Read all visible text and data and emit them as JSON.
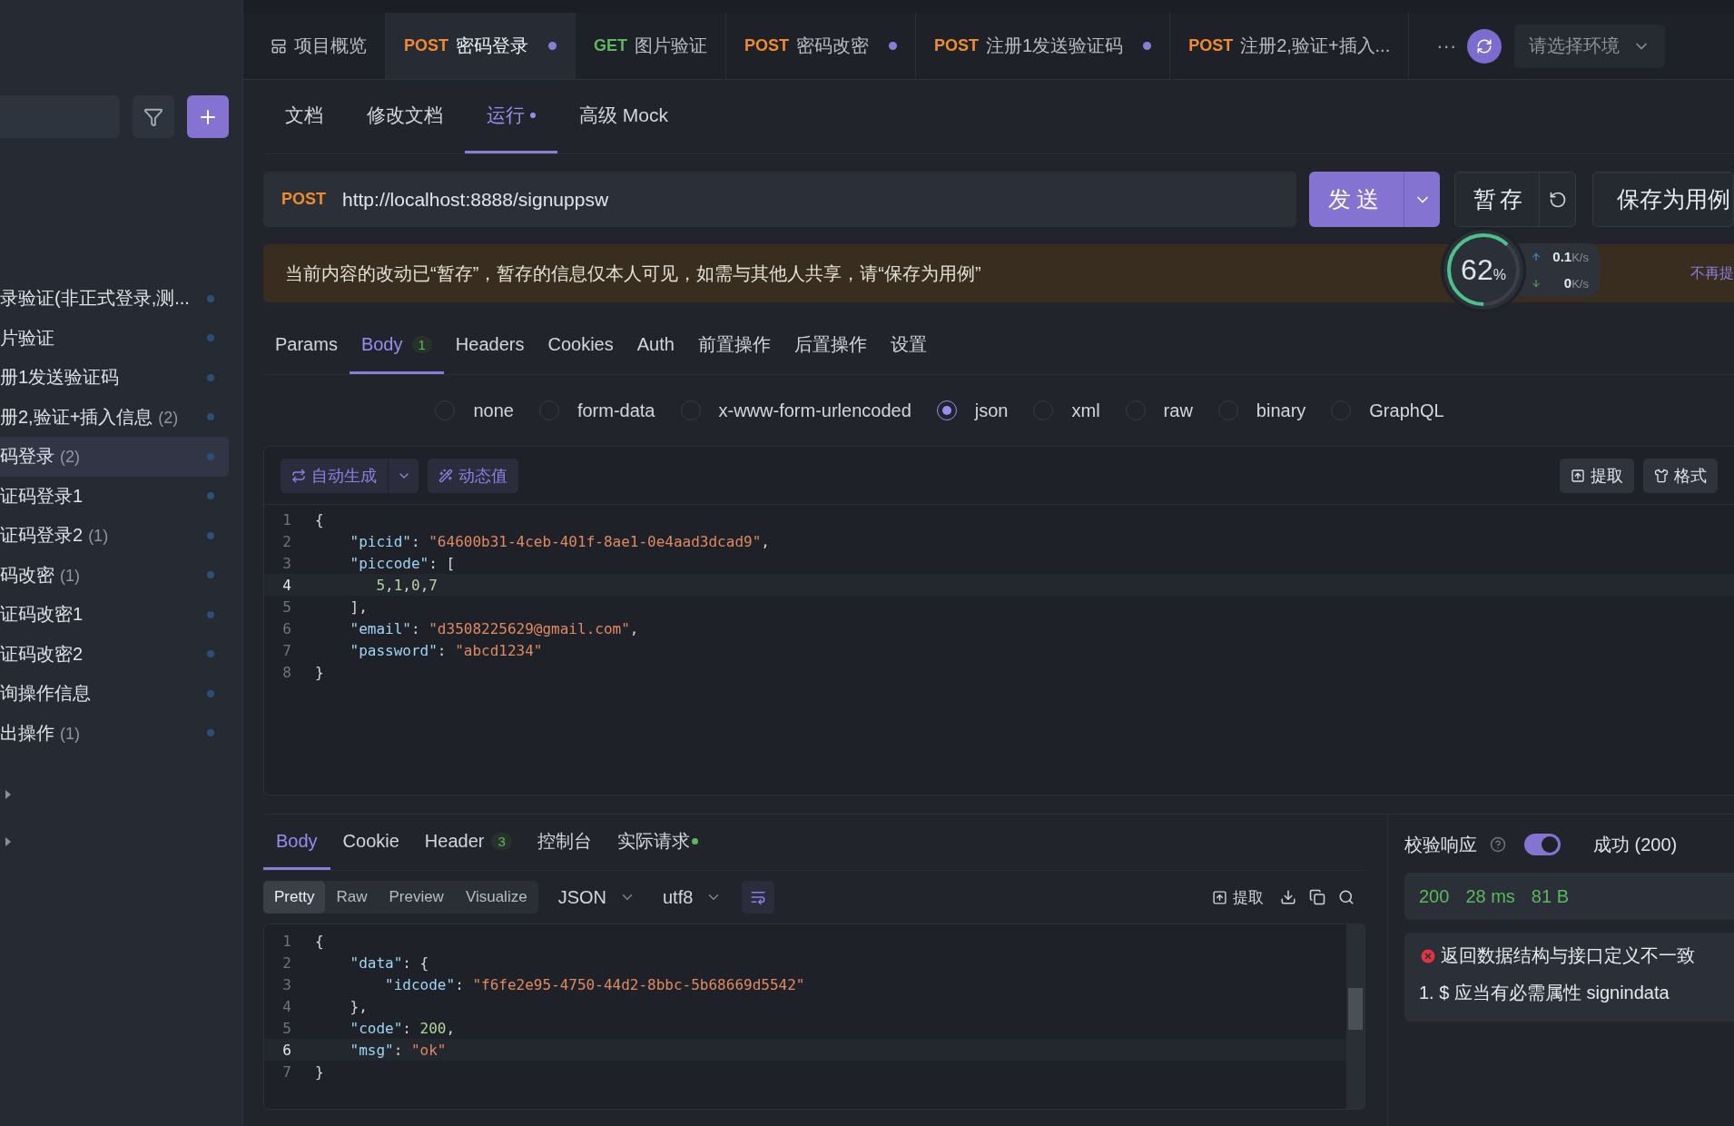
{
  "top_tabs": [
    {
      "kind": "overview",
      "label": "项目概览",
      "selected": false,
      "modified": false
    },
    {
      "kind": "request",
      "method": "POST",
      "label": "密码登录",
      "selected": true,
      "modified": true
    },
    {
      "kind": "request",
      "method": "GET",
      "label": "图片验证",
      "selected": false,
      "modified": false
    },
    {
      "kind": "request",
      "method": "POST",
      "label": "密码改密",
      "selected": false,
      "modified": true
    },
    {
      "kind": "request",
      "method": "POST",
      "label": "注册1发送验证码",
      "selected": false,
      "modified": true
    },
    {
      "kind": "request",
      "method": "POST",
      "label": "注册2,验证+插入...",
      "selected": false,
      "modified": false
    }
  ],
  "more_button": "···",
  "environment": {
    "placeholder": "请选择环境"
  },
  "sidebar_items": [
    {
      "label": "录验证(非正式登录,测...",
      "selected": false
    },
    {
      "label": "片验证",
      "selected": false
    },
    {
      "label": "册1发送验证码",
      "selected": false
    },
    {
      "label": "册2,验证+插入信息",
      "count": "(2)",
      "selected": false
    },
    {
      "label": "码登录",
      "count": "(2)",
      "selected": true
    },
    {
      "label": "证码登录1",
      "selected": false
    },
    {
      "label": "证码登录2",
      "count": "(1)",
      "selected": false
    },
    {
      "label": "码改密",
      "count": "(1)",
      "selected": false
    },
    {
      "label": "证码改密1",
      "selected": false
    },
    {
      "label": "证码改密2",
      "selected": false
    },
    {
      "label": "询操作信息",
      "selected": false
    },
    {
      "label": "出操作",
      "count": "(1)",
      "selected": false
    }
  ],
  "sidebar_folders": [
    {
      "expanded": false
    },
    {
      "expanded": false
    }
  ],
  "sub_tabs": [
    {
      "label": "文档",
      "selected": false,
      "modified": false
    },
    {
      "label": "修改文档",
      "selected": false,
      "modified": false
    },
    {
      "label": "运行",
      "selected": true,
      "modified": true
    },
    {
      "label": "高级 Mock",
      "selected": false,
      "modified": false
    }
  ],
  "request": {
    "method": "POST",
    "url": "http://localhost:8888/signuppsw",
    "send": "发送",
    "stash": "暂存",
    "save_as_case": "保存为用例"
  },
  "monitor": {
    "level": 0.62,
    "percent": "62",
    "unit": "%",
    "upload": "0.1",
    "upload_unit": "K/s",
    "download": "0",
    "download_unit": "K/s"
  },
  "notice": {
    "text": "当前内容的改动已“暂存”，暂存的信息仅本人可见，如需与其他人共享，请“保存为用例”",
    "dismiss": "不再提"
  },
  "body_tabs": [
    {
      "label": "Params",
      "selected": false
    },
    {
      "label": "Body",
      "badge": "1",
      "selected": true
    },
    {
      "label": "Headers",
      "selected": false
    },
    {
      "label": "Cookies",
      "selected": false
    },
    {
      "label": "Auth",
      "selected": false
    },
    {
      "label": "前置操作",
      "selected": false
    },
    {
      "label": "后置操作",
      "selected": false
    },
    {
      "label": "设置",
      "selected": false
    }
  ],
  "body_types": [
    {
      "label": "none",
      "selected": false
    },
    {
      "label": "form-data",
      "selected": false
    },
    {
      "label": "x-www-form-urlencoded",
      "selected": false
    },
    {
      "label": "json",
      "selected": true
    },
    {
      "label": "xml",
      "selected": false
    },
    {
      "label": "raw",
      "selected": false
    },
    {
      "label": "binary",
      "selected": false
    },
    {
      "label": "GraphQL",
      "selected": false
    }
  ],
  "editor_toolbar": {
    "auto_generate": "自动生成",
    "dynamic_value": "动态值",
    "extract": "提取",
    "format": "格式"
  },
  "request_body": [
    {
      "n": "1",
      "current": false,
      "tokens": [
        {
          "kind": "punct",
          "text": "{"
        }
      ]
    },
    {
      "n": "2",
      "current": false,
      "tokens": [
        {
          "kind": "key",
          "text": "    \"picid\""
        },
        {
          "kind": "punct",
          "text": ": "
        },
        {
          "kind": "str",
          "text": "\"64600b31-4ceb-401f-8ae1-0e4aad3dcad9\""
        },
        {
          "kind": "punct",
          "text": ","
        }
      ]
    },
    {
      "n": "3",
      "current": false,
      "tokens": [
        {
          "kind": "key",
          "text": "    \"piccode\""
        },
        {
          "kind": "punct",
          "text": ": ["
        }
      ]
    },
    {
      "n": "4",
      "current": true,
      "tokens": [
        {
          "kind": "num",
          "text": "       5"
        },
        {
          "kind": "punct",
          "text": ","
        },
        {
          "kind": "num",
          "text": "1"
        },
        {
          "kind": "punct",
          "text": ","
        },
        {
          "kind": "num",
          "text": "0"
        },
        {
          "kind": "punct",
          "text": ","
        },
        {
          "kind": "num",
          "text": "7"
        }
      ]
    },
    {
      "n": "5",
      "current": false,
      "tokens": [
        {
          "kind": "punct",
          "text": "    ],"
        }
      ]
    },
    {
      "n": "6",
      "current": false,
      "tokens": [
        {
          "kind": "key",
          "text": "    \"email\""
        },
        {
          "kind": "punct",
          "text": ": "
        },
        {
          "kind": "str",
          "text": "\"d3508225629@gmail.com\""
        },
        {
          "kind": "punct",
          "text": ","
        }
      ]
    },
    {
      "n": "7",
      "current": false,
      "tokens": [
        {
          "kind": "key",
          "text": "    \"password\""
        },
        {
          "kind": "punct",
          "text": ": "
        },
        {
          "kind": "str",
          "text": "\"abcd1234\""
        }
      ]
    },
    {
      "n": "8",
      "current": false,
      "tokens": [
        {
          "kind": "punct",
          "text": "}"
        }
      ]
    }
  ],
  "response": {
    "tabs": [
      {
        "label": "Body",
        "selected": true,
        "indicator": false
      },
      {
        "label": "Cookie",
        "selected": false,
        "indicator": false
      },
      {
        "label": "Header",
        "badge": "3",
        "selected": false,
        "indicator": false
      },
      {
        "label": "控制台",
        "selected": false,
        "indicator": false
      },
      {
        "label": "实际请求",
        "selected": false,
        "indicator": true
      }
    ],
    "views": [
      {
        "label": "Pretty",
        "selected": true
      },
      {
        "label": "Raw",
        "selected": false
      },
      {
        "label": "Preview",
        "selected": false
      },
      {
        "label": "Visualize",
        "selected": false
      }
    ],
    "format": "JSON",
    "encoding": "utf8",
    "extract": "提取",
    "lines": [
      {
        "n": "1",
        "current": false,
        "tokens": [
          {
            "kind": "punct",
            "text": "{"
          }
        ]
      },
      {
        "n": "2",
        "current": false,
        "tokens": [
          {
            "kind": "key",
            "text": "    \"data\""
          },
          {
            "kind": "punct",
            "text": ": {"
          }
        ]
      },
      {
        "n": "3",
        "current": false,
        "tokens": [
          {
            "kind": "key",
            "text": "        \"idcode\""
          },
          {
            "kind": "punct",
            "text": ": "
          },
          {
            "kind": "str",
            "text": "\"f6fe2e95-4750-44d2-8bbc-5b68669d5542\""
          }
        ]
      },
      {
        "n": "4",
        "current": false,
        "tokens": [
          {
            "kind": "punct",
            "text": "    },"
          }
        ]
      },
      {
        "n": "5",
        "current": false,
        "tokens": [
          {
            "kind": "key",
            "text": "    \"code\""
          },
          {
            "kind": "punct",
            "text": ": "
          },
          {
            "kind": "num",
            "text": "200"
          },
          {
            "kind": "punct",
            "text": ","
          }
        ]
      },
      {
        "n": "6",
        "current": true,
        "tokens": [
          {
            "kind": "key",
            "text": "    \"msg\""
          },
          {
            "kind": "punct",
            "text": ": "
          },
          {
            "kind": "str",
            "text": "\"ok\""
          }
        ]
      },
      {
        "n": "7",
        "current": false,
        "tokens": [
          {
            "kind": "punct",
            "text": "}"
          }
        ]
      }
    ]
  },
  "validation": {
    "label": "校验响应",
    "enabled": true,
    "result": "成功 (200)",
    "status": "200",
    "time": "28 ms",
    "size": "81 B",
    "error": "返回数据结构与接口定义不一致",
    "details": [
      "1. $ 应当有必需属性 signindata"
    ]
  }
}
